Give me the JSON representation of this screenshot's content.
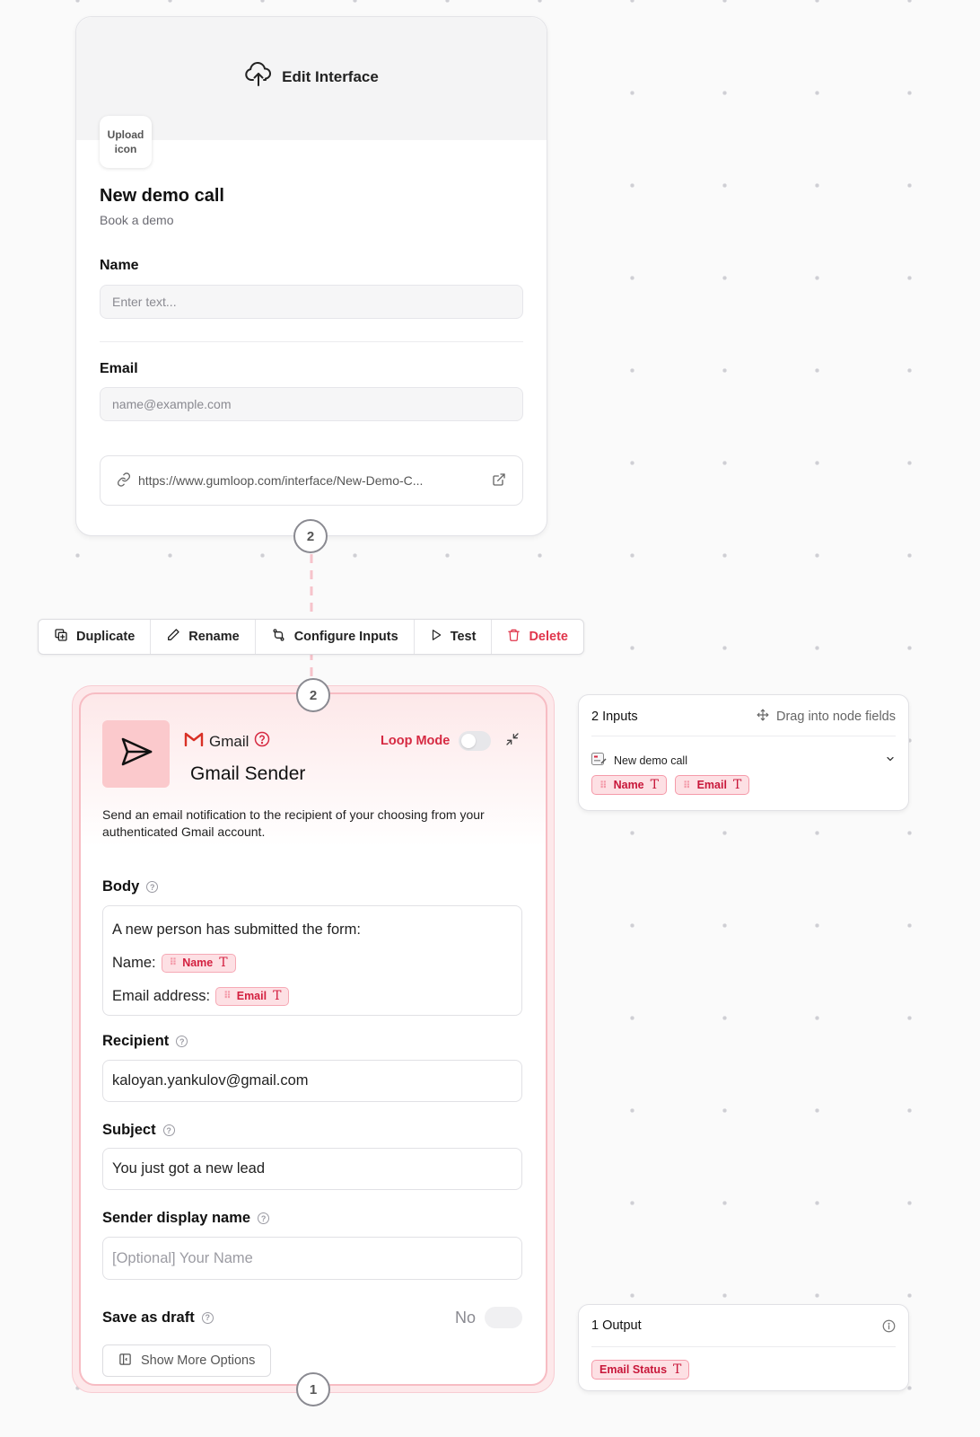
{
  "interface": {
    "banner_label": "Edit Interface",
    "upload_icon_label": "Upload icon",
    "title": "New demo call",
    "subtitle": "Book a demo",
    "fields": [
      {
        "label": "Name",
        "placeholder": "Enter text..."
      },
      {
        "label": "Email",
        "placeholder": "name@example.com"
      }
    ],
    "url": "https://www.gumloop.com/interface/New-Demo-C..."
  },
  "connectors": {
    "top_badge": "2",
    "node_top_badge": "2",
    "node_bottom_badge": "1"
  },
  "toolbar": {
    "duplicate": "Duplicate",
    "rename": "Rename",
    "configure": "Configure Inputs",
    "test": "Test",
    "delete": "Delete"
  },
  "node": {
    "provider": "Gmail",
    "title": "Gmail Sender",
    "loop_mode": "Loop Mode",
    "description": "Send an email notification to the recipient of your choosing from your authenticated Gmail account.",
    "body": {
      "label": "Body",
      "line1": "A new person has submitted the form:",
      "line2_prefix": "Name:",
      "line2_chip": "Name",
      "line3_prefix": "Email address:",
      "line3_chip": "Email"
    },
    "recipient": {
      "label": "Recipient",
      "value": "kaloyan.yankulov@gmail.com"
    },
    "subject": {
      "label": "Subject",
      "value": "You just got a new lead"
    },
    "sender_name": {
      "label": "Sender display name",
      "placeholder": "[Optional] Your Name"
    },
    "draft": {
      "label": "Save as draft",
      "value": "No"
    },
    "more_options": "Show More Options"
  },
  "inputs_panel": {
    "title": "2 Inputs",
    "hint": "Drag into node fields",
    "source": "New demo call",
    "chips": [
      "Name",
      "Email"
    ]
  },
  "outputs_panel": {
    "title": "1 Output",
    "chips": [
      "Email Status"
    ]
  },
  "colors": {
    "accent": "#d62a42",
    "node_tint": "#fde8ea",
    "chip_bg": "#fde0e4"
  }
}
